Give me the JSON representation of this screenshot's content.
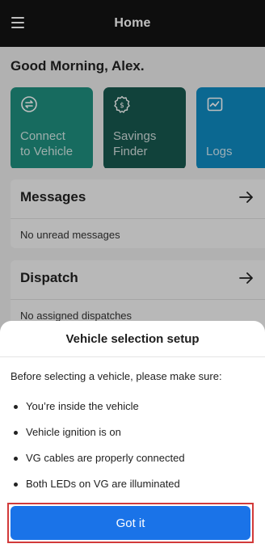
{
  "header": {
    "title": "Home",
    "menu_icon": "menu-icon"
  },
  "greeting": "Good Morning, Alex.",
  "tiles": [
    {
      "label_line1": "Connect",
      "label_line2": "to Vehicle",
      "icon": "connect-icon",
      "color": "#1f8f7f"
    },
    {
      "label_line1": "Savings",
      "label_line2": "Finder",
      "icon": "savings-icon",
      "color": "#17584f"
    },
    {
      "label_line1": "Logs",
      "label_line2": "",
      "icon": "logs-icon",
      "color": "#0f8bc2"
    }
  ],
  "messages": {
    "title": "Messages",
    "empty_text": "No unread messages"
  },
  "dispatch": {
    "title": "Dispatch",
    "empty_text": "No assigned dispatches"
  },
  "sheet": {
    "title": "Vehicle selection setup",
    "intro": "Before selecting a vehicle, please make sure:",
    "items": [
      "You’re inside the vehicle",
      "Vehicle ignition is on",
      "VG cables are properly connected",
      "Both LEDs on VG are illuminated"
    ],
    "button_label": "Got it",
    "button_color": "#1a73e8"
  }
}
